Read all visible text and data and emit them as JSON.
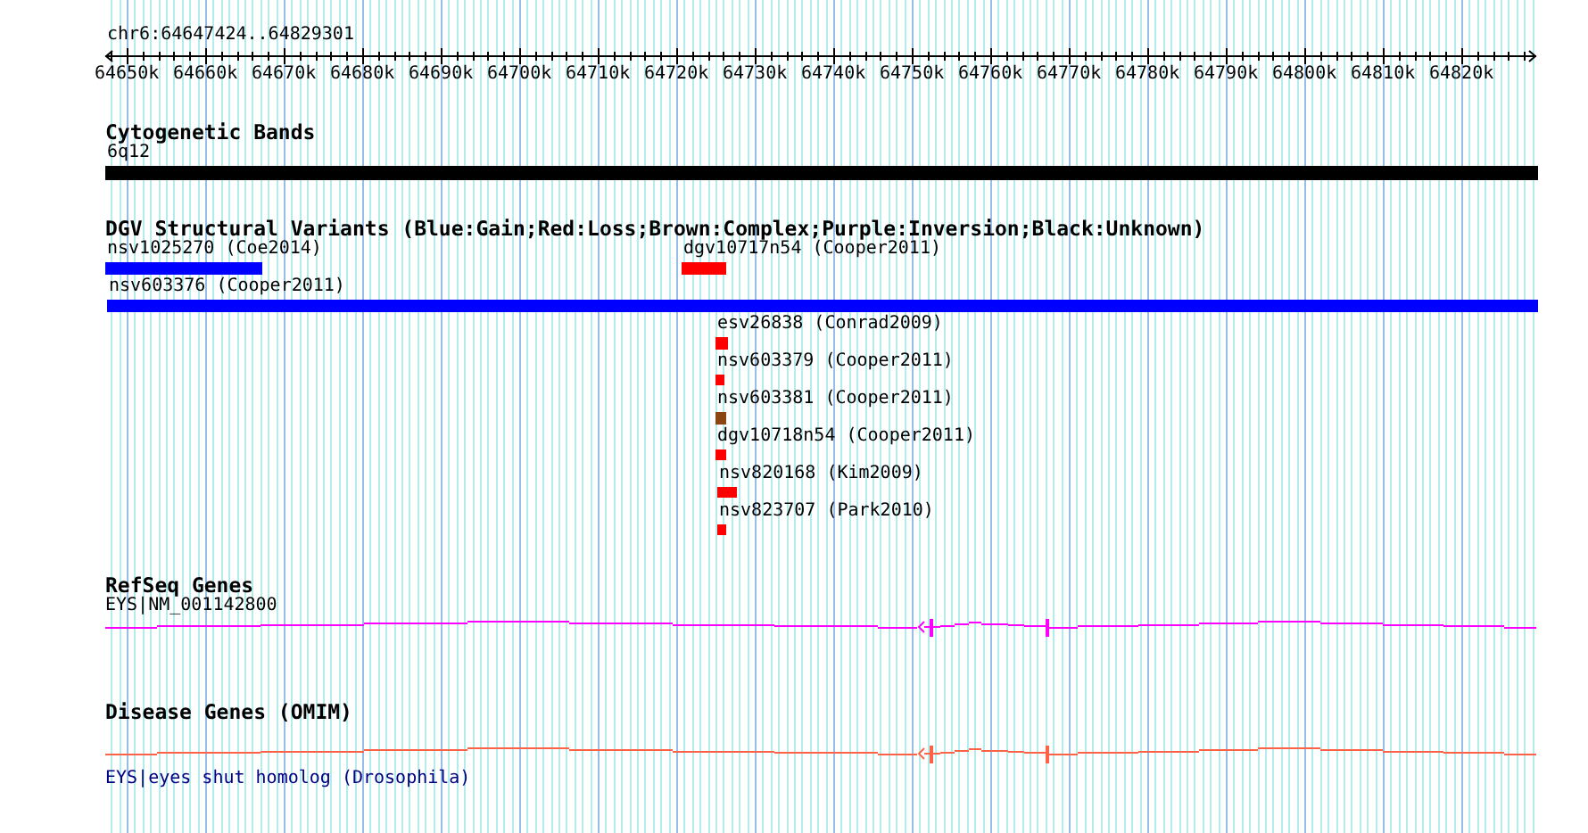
{
  "axis": {
    "title": "chr6:64647424..64829301",
    "tick_labels": [
      "64650k",
      "64660k",
      "64670k",
      "64680k",
      "64690k",
      "64700k",
      "64710k",
      "64720k",
      "64730k",
      "64740k",
      "64750k",
      "64760k",
      "64770k",
      "64780k",
      "64790k",
      "64800k",
      "64810k",
      "64820k"
    ]
  },
  "tracks": [
    {
      "kind": "bands",
      "title": "Cytogenetic Bands",
      "bands": [
        {
          "label": "6q12"
        }
      ]
    },
    {
      "kind": "variants",
      "title": "DGV Structural Variants (Blue:Gain;Red:Loss;Brown:Complex;Purple:Inversion;Black:Unknown)",
      "items": [
        {
          "label": "nsv1025270 (Coe2014)",
          "color": "#0000ff"
        },
        {
          "label": "dgv10717n54 (Cooper2011)",
          "color": "#ff0000"
        },
        {
          "label": "nsv603376 (Cooper2011)",
          "color": "#0000ff"
        },
        {
          "label": "esv26838 (Conrad2009)",
          "color": "#ff0000"
        },
        {
          "label": "nsv603379 (Cooper2011)",
          "color": "#ff0000"
        },
        {
          "label": "nsv603381 (Cooper2011)",
          "color": "#8b4513"
        },
        {
          "label": "dgv10718n54 (Cooper2011)",
          "color": "#ff0000"
        },
        {
          "label": "nsv820168 (Kim2009)",
          "color": "#ff0000"
        },
        {
          "label": "nsv823707 (Park2010)",
          "color": "#ff0000"
        }
      ]
    },
    {
      "kind": "genes",
      "title": "RefSeq Genes",
      "genes": [
        {
          "label": "EYS|NM_001142800",
          "color": "#ff00ff",
          "link": false
        }
      ]
    },
    {
      "kind": "genes",
      "title": "Disease Genes (OMIM)",
      "genes": [
        {
          "label": "EYS|eyes shut homolog (Drosophila)",
          "color": "#ff6347",
          "link": true
        }
      ]
    }
  ]
}
